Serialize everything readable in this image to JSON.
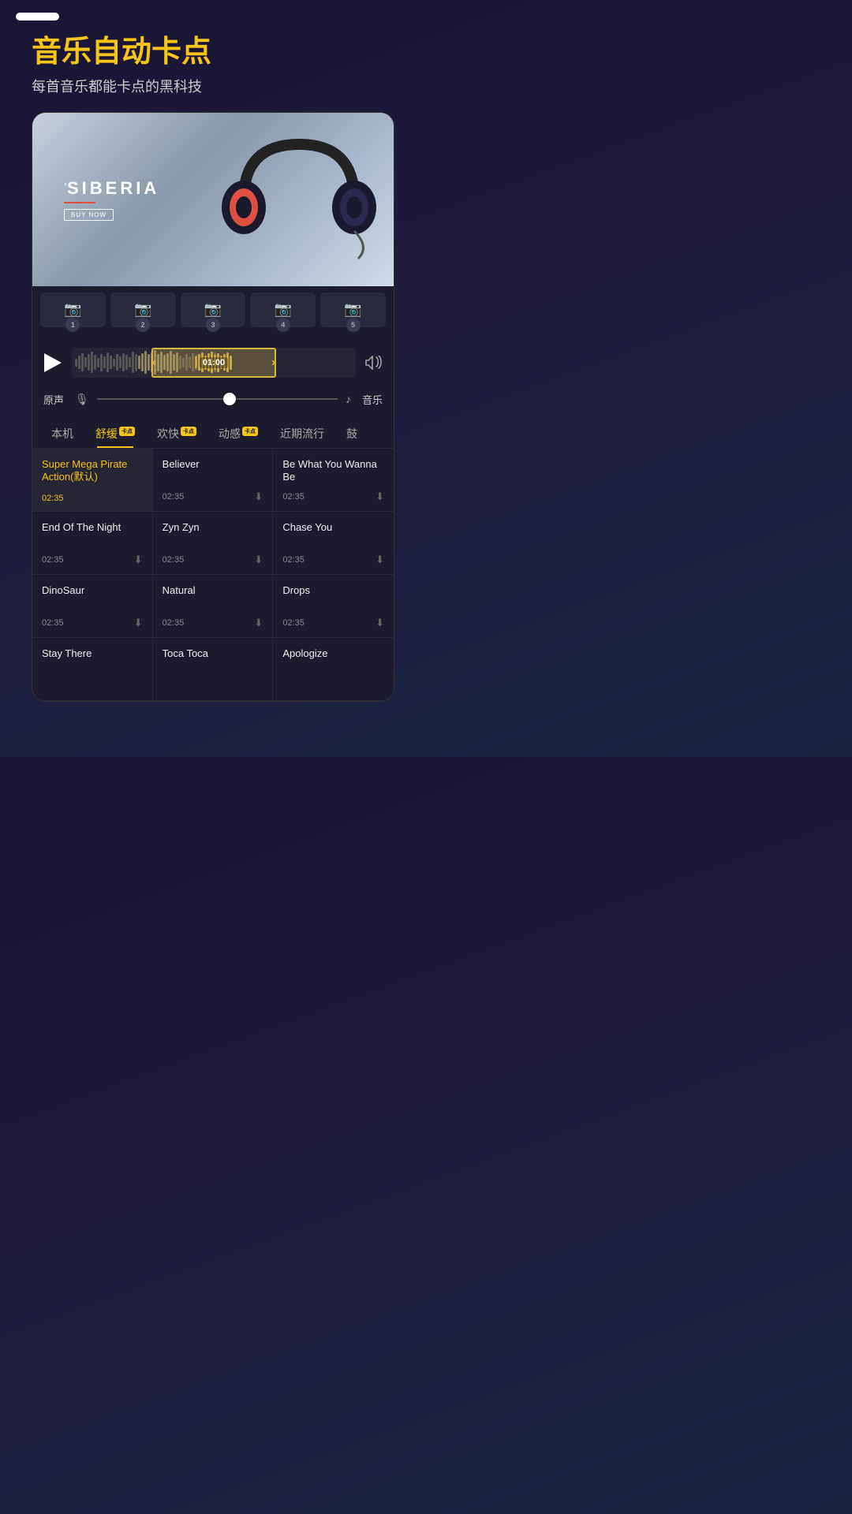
{
  "app": {
    "title": "音乐自动卡点",
    "subtitle": "每首音乐都能卡点的黑科技"
  },
  "status": {
    "pill": ""
  },
  "brand": {
    "degree": "°",
    "name": "SIBERIA",
    "buy_label": "BUY NOW"
  },
  "thumbnails": [
    {
      "num": "1"
    },
    {
      "num": "2"
    },
    {
      "num": "3"
    },
    {
      "num": "4"
    },
    {
      "num": "5"
    }
  ],
  "waveform": {
    "time": "01:00"
  },
  "audio": {
    "original_label": "原声",
    "music_label": "音乐"
  },
  "tabs": [
    {
      "label": "本机",
      "active": false,
      "badge": false
    },
    {
      "label": "舒缓",
      "active": true,
      "badge": true
    },
    {
      "label": "欢快",
      "active": false,
      "badge": true
    },
    {
      "label": "动感",
      "active": false,
      "badge": true
    },
    {
      "label": "近期流行",
      "active": false,
      "badge": false
    },
    {
      "label": "鼓",
      "active": false,
      "badge": false
    }
  ],
  "music_list": [
    {
      "name": "Super Mega Pirate Action(默认)",
      "time": "02:35",
      "download": false,
      "highlight": true
    },
    {
      "name": "Believer",
      "time": "02:35",
      "download": true,
      "highlight": false
    },
    {
      "name": "Be What You Wanna Be",
      "time": "02:35",
      "download": true,
      "highlight": false
    },
    {
      "name": "End Of The Night",
      "time": "02:35",
      "download": true,
      "highlight": false
    },
    {
      "name": "Zyn Zyn",
      "time": "02:35",
      "download": true,
      "highlight": false
    },
    {
      "name": "Chase You",
      "time": "02:35",
      "download": true,
      "highlight": false
    },
    {
      "name": "DinoSaur",
      "time": "02:35",
      "download": true,
      "highlight": false
    },
    {
      "name": "Natural",
      "time": "02:35",
      "download": true,
      "highlight": false
    },
    {
      "name": "Drops",
      "time": "02:35",
      "download": true,
      "highlight": false
    },
    {
      "name": "Stay There",
      "time": "",
      "download": false,
      "highlight": false
    },
    {
      "name": "Toca Toca",
      "time": "",
      "download": false,
      "highlight": false
    },
    {
      "name": "Apologize",
      "time": "",
      "download": false,
      "highlight": false
    }
  ]
}
